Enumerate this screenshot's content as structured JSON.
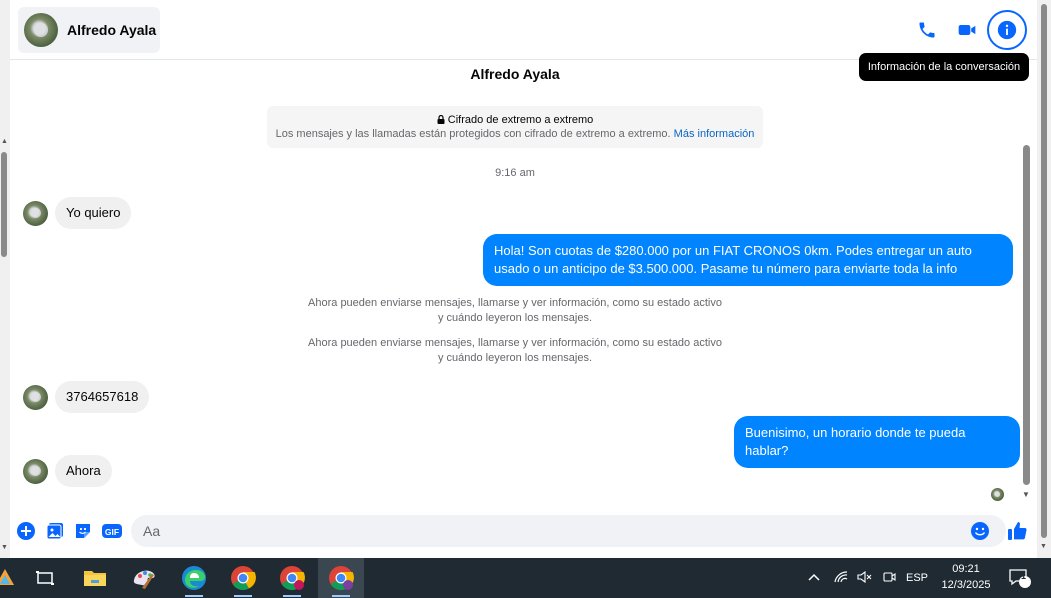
{
  "header": {
    "contact_name": "Alfredo Ayala",
    "actions": [
      "phone-icon",
      "video-camera-icon",
      "info-icon"
    ],
    "tooltip": "Información de la conversación"
  },
  "chat": {
    "title": "Alfredo Ayala",
    "encryption": {
      "title": "Cifrado de extremo a extremo",
      "body": "Los mensajes y las llamadas están protegidos con cifrado de extremo a extremo.",
      "link": "Más información"
    },
    "timestamp": "9:16 am",
    "messages": [
      {
        "dir": "in",
        "text": "Yo quiero"
      },
      {
        "dir": "out",
        "text": "Hola! Son cuotas de $280.000 por un FIAT CRONOS 0km. Podes entregar un auto usado o un anticipo de $3.500.000. Pasame tu número para enviarte toda la info"
      },
      {
        "dir": "sys",
        "line1": "Ahora pueden enviarse mensajes, llamarse y ver información, como su estado activo",
        "line2": "y cuándo leyeron los mensajes."
      },
      {
        "dir": "sys",
        "line1": "Ahora pueden enviarse mensajes, llamarse y ver información, como su estado activo",
        "line2": "y cuándo leyeron los mensajes."
      },
      {
        "dir": "in",
        "text": "3764657618"
      },
      {
        "dir": "out",
        "text": "Buenisimo, un horario donde te pueda hablar?"
      },
      {
        "dir": "in",
        "text": "Ahora"
      }
    ]
  },
  "composer": {
    "placeholder": "Aa",
    "tools": [
      "plus-icon",
      "image-icon",
      "sticker-icon",
      "gif-icon"
    ]
  },
  "taskbar": {
    "apps": [
      "task-view-icon",
      "file-explorer-icon",
      "paint-icon",
      "edge-icon",
      "chrome-icon",
      "chrome-profile-icon",
      "chrome-profile-2-icon"
    ],
    "tray": {
      "language": "ESP",
      "time": "09:21",
      "date": "12/3/2025",
      "notifications": "1"
    }
  },
  "colors": {
    "accent": "#0866ff",
    "bubble_out": "#0084ff",
    "taskbar": "#1f2a33"
  }
}
